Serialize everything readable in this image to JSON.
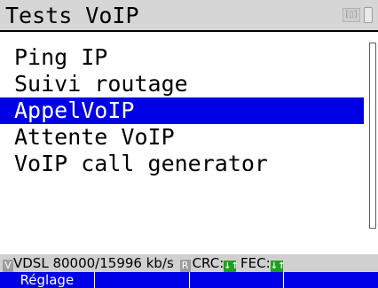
{
  "header": {
    "title": "Tests VoIP",
    "lan_icon_glyph": "[▯]",
    "battery_icon": "battery-icon"
  },
  "menu": {
    "items": [
      {
        "label": "Ping IP",
        "selected": false
      },
      {
        "label": "Suivi routage",
        "selected": false
      },
      {
        "label": "AppelVoIP",
        "selected": true
      },
      {
        "label": "Attente VoIP",
        "selected": false
      },
      {
        "label": "VoIP call generator",
        "selected": false
      }
    ]
  },
  "status": {
    "v_badge": "V",
    "link_text": "VDSL 80000/15996 kb/s",
    "r_badge": "R",
    "crc_label": "CRC:",
    "crc_arrows": "↓↑",
    "fec_label": "FEC:",
    "fec_arrows": "↓↑"
  },
  "softkeys": [
    "Réglage",
    "",
    "",
    ""
  ],
  "colors": {
    "selection": "#0000e6",
    "softkey_bg": "#0000e6",
    "ok_green": "#1ea01e",
    "title_bg": "#d6d6d6",
    "status_bg": "#d0d0d0"
  }
}
